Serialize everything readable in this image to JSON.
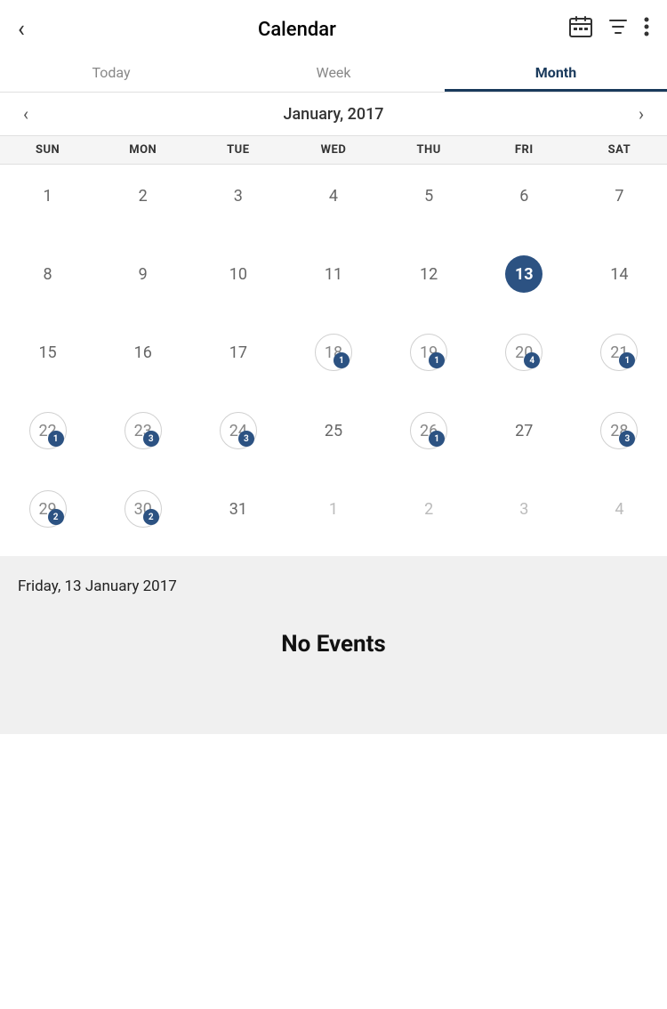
{
  "header": {
    "back_label": "‹",
    "title": "Calendar",
    "calendar_icon": "📅",
    "filter_icon": "⊿",
    "more_icon": "⋮"
  },
  "tabs": [
    {
      "id": "today",
      "label": "Today",
      "active": false
    },
    {
      "id": "week",
      "label": "Week",
      "active": false
    },
    {
      "id": "month",
      "label": "Month",
      "active": true
    }
  ],
  "month_nav": {
    "prev_arrow": "‹",
    "next_arrow": "›",
    "title": "January, 2017"
  },
  "day_headers": [
    "SUN",
    "MON",
    "TUE",
    "WED",
    "THU",
    "FRI",
    "SAT"
  ],
  "weeks": [
    [
      {
        "day": 1,
        "type": "normal",
        "badge": null
      },
      {
        "day": 2,
        "type": "normal",
        "badge": null
      },
      {
        "day": 3,
        "type": "normal",
        "badge": null
      },
      {
        "day": 4,
        "type": "normal",
        "badge": null
      },
      {
        "day": 5,
        "type": "normal",
        "badge": null
      },
      {
        "day": 6,
        "type": "normal",
        "badge": null
      },
      {
        "day": 7,
        "type": "normal",
        "badge": null
      }
    ],
    [
      {
        "day": 8,
        "type": "normal",
        "badge": null
      },
      {
        "day": 9,
        "type": "normal",
        "badge": null
      },
      {
        "day": 10,
        "type": "normal",
        "badge": null
      },
      {
        "day": 11,
        "type": "normal",
        "badge": null
      },
      {
        "day": 12,
        "type": "normal",
        "badge": null
      },
      {
        "day": 13,
        "type": "today",
        "badge": null
      },
      {
        "day": 14,
        "type": "normal",
        "badge": null
      }
    ],
    [
      {
        "day": 15,
        "type": "normal",
        "badge": null
      },
      {
        "day": 16,
        "type": "normal",
        "badge": null
      },
      {
        "day": 17,
        "type": "normal",
        "badge": null
      },
      {
        "day": 18,
        "type": "circle",
        "badge": 1
      },
      {
        "day": 19,
        "type": "circle",
        "badge": 1
      },
      {
        "day": 20,
        "type": "circle",
        "badge": 4
      },
      {
        "day": 21,
        "type": "circle",
        "badge": 1
      }
    ],
    [
      {
        "day": 22,
        "type": "circle",
        "badge": 1
      },
      {
        "day": 23,
        "type": "circle",
        "badge": 3
      },
      {
        "day": 24,
        "type": "circle",
        "badge": 3
      },
      {
        "day": 25,
        "type": "normal",
        "badge": null
      },
      {
        "day": 26,
        "type": "circle",
        "badge": 1
      },
      {
        "day": 27,
        "type": "normal",
        "badge": null
      },
      {
        "day": 28,
        "type": "circle",
        "badge": 3
      }
    ],
    [
      {
        "day": 29,
        "type": "circle",
        "badge": 2
      },
      {
        "day": 30,
        "type": "circle",
        "badge": 2
      },
      {
        "day": 31,
        "type": "normal",
        "badge": null
      },
      {
        "day": 1,
        "type": "grayed",
        "badge": null
      },
      {
        "day": 2,
        "type": "grayed",
        "badge": null
      },
      {
        "day": 3,
        "type": "grayed",
        "badge": null
      },
      {
        "day": 4,
        "type": "grayed",
        "badge": null
      }
    ]
  ],
  "selected_date_label": "Friday, 13 January 2017",
  "no_events_label": "No Events"
}
